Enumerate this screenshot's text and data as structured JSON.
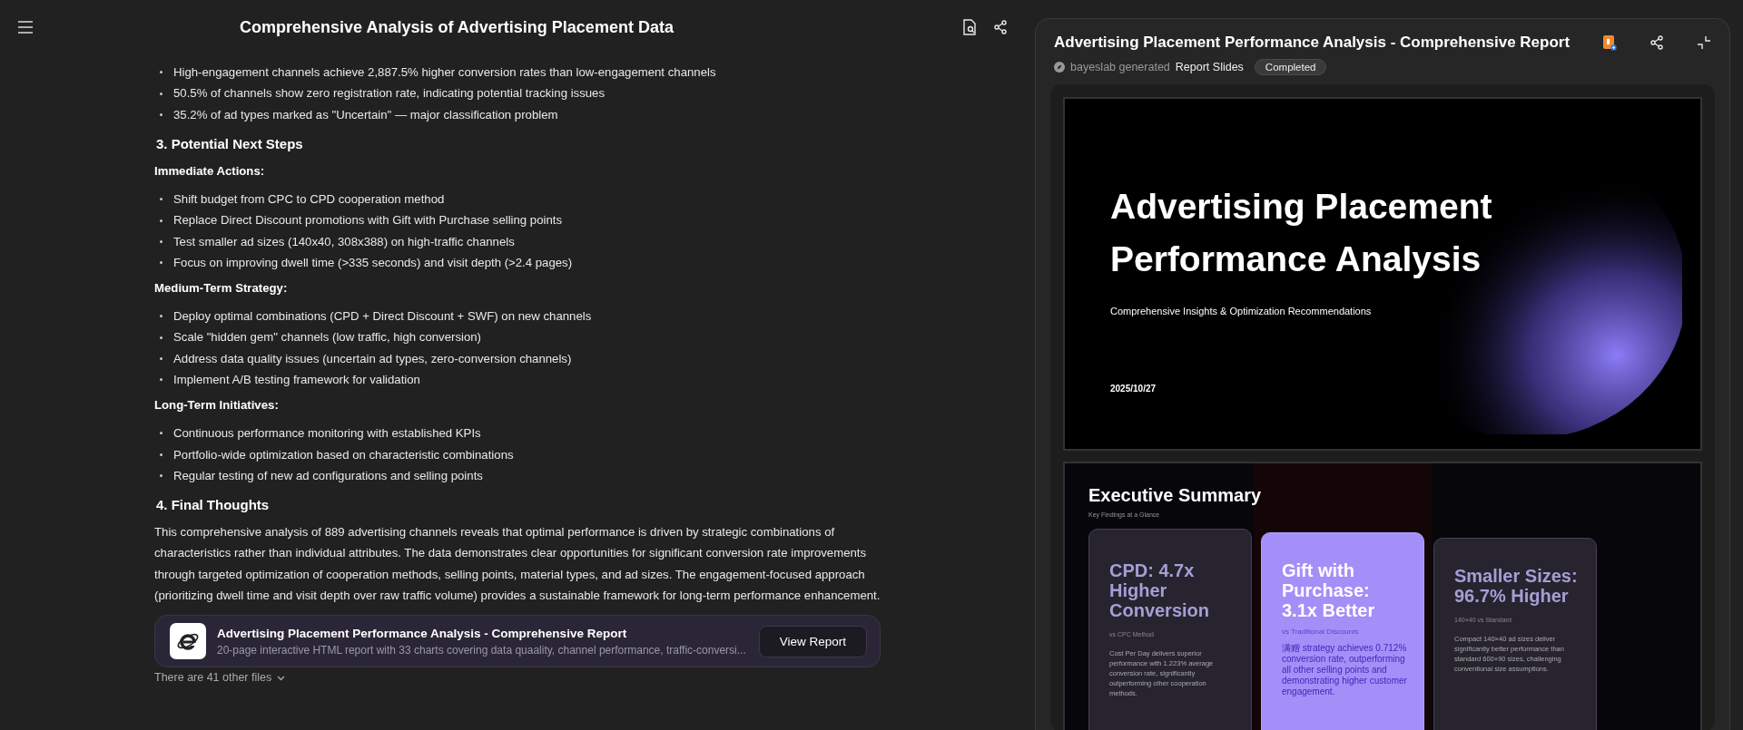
{
  "header": {
    "title": "Comprehensive Analysis of Advertising Placement Data"
  },
  "content": [
    {
      "kind": "bullet",
      "text": "High-engagement channels achieve 2,887.5% higher conversion rates than low-engagement channels"
    },
    {
      "kind": "bullet",
      "text": "50.5% of channels show zero registration rate, indicating potential tracking issues"
    },
    {
      "kind": "bullet",
      "text": "35.2% of ad types marked as \"Uncertain\" — major classification problem"
    },
    {
      "kind": "heading",
      "text": "3. Potential Next Steps"
    },
    {
      "kind": "subheading",
      "text": "Immediate Actions:"
    },
    {
      "kind": "bullet",
      "text": "Shift budget from CPC to CPD cooperation method"
    },
    {
      "kind": "bullet",
      "text": "Replace Direct Discount promotions with Gift with Purchase selling points"
    },
    {
      "kind": "bullet",
      "text": "Test smaller ad sizes (140x40, 308x388) on high-traffic channels"
    },
    {
      "kind": "bullet",
      "text": "Focus on improving dwell time (>335 seconds) and visit depth (>2.4 pages)"
    },
    {
      "kind": "subheading",
      "text": "Medium-Term Strategy:"
    },
    {
      "kind": "bullet",
      "text": "Deploy optimal combinations (CPD + Direct Discount + SWF) on new channels"
    },
    {
      "kind": "bullet",
      "text": "Scale \"hidden gem\" channels (low traffic, high conversion)"
    },
    {
      "kind": "bullet",
      "text": "Address data quality issues (uncertain ad types, zero-conversion channels)"
    },
    {
      "kind": "bullet",
      "text": "Implement A/B testing framework for validation"
    },
    {
      "kind": "subheading",
      "text": "Long-Term Initiatives:"
    },
    {
      "kind": "bullet",
      "text": "Continuous performance monitoring with established KPIs"
    },
    {
      "kind": "bullet",
      "text": "Portfolio-wide optimization based on characteristic combinations"
    },
    {
      "kind": "bullet",
      "text": "Regular testing of new ad configurations and selling points"
    },
    {
      "kind": "heading",
      "text": "4. Final Thoughts"
    },
    {
      "kind": "paragraph",
      "text": "This comprehensive analysis of 889 advertising channels reveals that optimal performance is driven by strategic combinations of characteristics rather than individual attributes. The data demonstrates clear opportunities for significant conversion rate improvements through targeted optimization of cooperation methods, selling points, material types, and ad sizes. The engagement-focused approach (prioritizing dwell time and visit depth over raw traffic volume) provides a sustainable framework for long-term performance enhancement."
    }
  ],
  "file_card": {
    "title": "Advertising Placement Performance Analysis - Comprehensive Report",
    "description": "20-page interactive HTML report with 33 charts covering data quaality, channel performance, traffic-conversi...",
    "button": "View Report"
  },
  "other_files": "There are 41 other files",
  "panel": {
    "title": "Advertising Placement Performance Analysis - Comprehensive Report",
    "generator": "bayeslab generated",
    "type": "Report Slides",
    "status": "Completed"
  },
  "slides": [
    {
      "kind": "title",
      "title": "Advertising Placement Performance Analysis",
      "subtitle": "Comprehensive Insights & Optimization Recommendations",
      "date": "2025/10/27"
    },
    {
      "kind": "summary",
      "title": "Executive Summary",
      "subtitle": "Key Findings at a Glance",
      "cards": [
        {
          "heading": "CPD: 4.7x Higher Conversion",
          "note": "vs CPC Method",
          "body": "Cost Per Day delivers superior performance with 1.223% average conversion rate, significantly outperforming other cooperation methods.",
          "highlighted": false
        },
        {
          "heading": "Gift with Purchase: 3.1x Better",
          "note": "vs Traditional Discounts",
          "body": "满赠 strategy achieves 0.712% conversion rate, outperforming all other selling points and demonstrating higher customer engagement.",
          "highlighted": true
        },
        {
          "heading": "Smaller Sizes: 96.7% Higher",
          "note": "140×40 vs Standard",
          "body": "Compact 140×40 ad sizes deliver significantly better performance than standard 600×90 sizes, challenging conventional size assumptions.",
          "highlighted": false
        }
      ]
    }
  ]
}
